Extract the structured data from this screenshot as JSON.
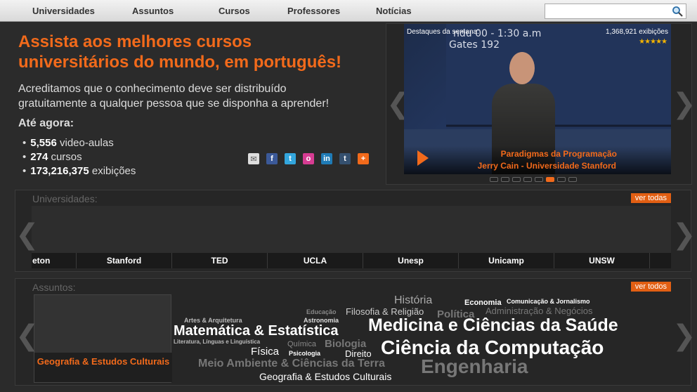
{
  "nav": {
    "items": [
      "Universidades",
      "Assuntos",
      "Cursos",
      "Professores",
      "Notícias"
    ],
    "search_value": ""
  },
  "hero": {
    "title_line1": "Assista aos melhores cursos",
    "title_line2": "universitários do mundo, em português!",
    "subtitle_line1": "Acreditamos que o conhecimento deve ser distribuído",
    "subtitle_line2": "gratuitamente a qualquer pessoa que se disponha a aprender!",
    "ate_agora": "Até agora:",
    "stats": [
      {
        "number": "5,556",
        "label": "video-aulas"
      },
      {
        "number": "274",
        "label": "cursos"
      },
      {
        "number": "173,216,375",
        "label": "exibições"
      }
    ],
    "share_icons": [
      "email-icon",
      "facebook-icon",
      "twitter-icon",
      "orkut-icon",
      "linkedin-icon",
      "tumblr-icon",
      "plus-icon"
    ]
  },
  "featured": {
    "weekly_label": "Destaques da semana:",
    "views": "1,368,921 exibições",
    "stars": "★★★★★",
    "title": "Paradigmas da Programação",
    "subtitle": "Jerry Cain - Universidade Stanford",
    "active_dot": 5,
    "dot_count": 8
  },
  "universities": {
    "heading": "Universidades:",
    "see_all": "ver todas",
    "items": [
      "eton",
      "Stanford",
      "TED",
      "UCLA",
      "Unesp",
      "Unicamp",
      "UNSW"
    ]
  },
  "subjects": {
    "heading": "Assuntos:",
    "see_all": "ver todos",
    "selected": "Geografia & Estudos Culturais",
    "cloud": [
      "História",
      "Economia",
      "Comunicação & Jornalismo",
      "Educação",
      "Filosofia & Religião",
      "Política",
      "Administração & Negócios",
      "Artes & Arquitetura",
      "Astronomia",
      "Matemática & Estatística",
      "Medicina e Ciências da Saúde",
      "Literatura, Línguas e Linguística",
      "Química",
      "Biologia",
      "Física",
      "Psicologia",
      "Direito",
      "Ciência da Computação",
      "Meio Ambiente & Ciências da Terra",
      "Engenharia",
      "Geografia & Estudos Culturais"
    ]
  },
  "colors": {
    "accent": "#f26a1b",
    "background": "#2b2b2b"
  }
}
